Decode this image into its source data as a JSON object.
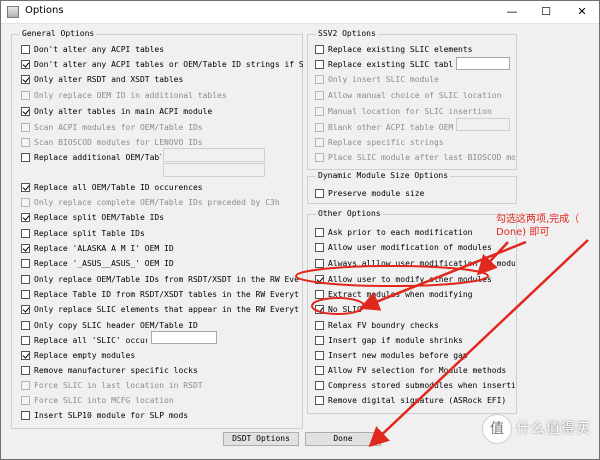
{
  "window": {
    "title": "Options",
    "minimize": "—",
    "maximize": "☐",
    "close": "✕"
  },
  "general": {
    "label": "General Options",
    "items": [
      {
        "label": "Don't alter any ACPI tables",
        "checked": false,
        "disabled": false
      },
      {
        "label": "Don't alter any ACPI tables or OEM/Table ID strings if SLIC IDs are",
        "checked": true,
        "disabled": false
      },
      {
        "label": "Only alter RSDT and XSDT tables",
        "checked": true,
        "disabled": false
      },
      {
        "label": "Only replace OEM ID in additional tables",
        "checked": false,
        "disabled": true
      },
      {
        "label": "Only alter tables in main ACPI module",
        "checked": true,
        "disabled": false
      },
      {
        "label": "Scan ACPI modules for OEM/Table IDs",
        "checked": false,
        "disabled": true
      },
      {
        "label": "Scan BIOSCOD modules for LENOVO IDs",
        "checked": false,
        "disabled": true
      },
      {
        "label": "Replace additional OEM/Table ID",
        "checked": false,
        "disabled": false
      },
      {
        "label": "Replace all OEM/Table ID occurences",
        "checked": true,
        "disabled": false
      },
      {
        "label": "Only replace complete OEM/Table IDs preceded by C3h",
        "checked": false,
        "disabled": true
      },
      {
        "label": "Replace split OEM/Table IDs",
        "checked": true,
        "disabled": false
      },
      {
        "label": "Replace split Table IDs",
        "checked": false,
        "disabled": false
      },
      {
        "label": "Replace 'ALASKA A M I' OEM ID",
        "checked": true,
        "disabled": false
      },
      {
        "label": "Replace '_ASUS__ASUS_' OEM ID",
        "checked": false,
        "disabled": false
      },
      {
        "label": "Only replace OEM/Table IDs from RSDT/XSDT in the RW Everything",
        "checked": false,
        "disabled": false
      },
      {
        "label": "Replace Table ID from RSDT/XSDT tables in the RW Everything report",
        "checked": false,
        "disabled": false
      },
      {
        "label": "Only replace SLIC elements that appear in the RW Everything report",
        "checked": true,
        "disabled": false
      },
      {
        "label": "Only copy SLIC header OEM/Table ID",
        "checked": false,
        "disabled": false
      },
      {
        "label": "Replace all 'SLIC' occurences",
        "checked": false,
        "disabled": false
      },
      {
        "label": "Replace empty modules",
        "checked": true,
        "disabled": false
      },
      {
        "label": "Remove manufacturer specific locks",
        "checked": false,
        "disabled": false
      },
      {
        "label": "Force SLIC in last location in RSDT",
        "checked": false,
        "disabled": true
      },
      {
        "label": "Force SLIC into MCFG location",
        "checked": false,
        "disabled": true
      },
      {
        "label": "Insert SLP10 module for SLP mods",
        "checked": false,
        "disabled": false
      }
    ]
  },
  "ssv2": {
    "label": "SSV2 Options",
    "items": [
      {
        "label": "Replace existing SLIC elements",
        "checked": false,
        "disabled": false
      },
      {
        "label": "Replace existing SLIC table ID with",
        "checked": false,
        "disabled": false
      },
      {
        "label": "Only insert SLIC module",
        "checked": false,
        "disabled": true
      },
      {
        "label": "Allow manual choice of SLIC location",
        "checked": false,
        "disabled": true
      },
      {
        "label": "Manual location for SLIC insertion",
        "checked": false,
        "disabled": true
      },
      {
        "label": "Blank other ACPI table OEM/Table",
        "checked": false,
        "disabled": true
      },
      {
        "label": "Replace specific strings",
        "checked": false,
        "disabled": true
      },
      {
        "label": "Place SLIC module after last BIOSCOD module",
        "checked": false,
        "disabled": true
      }
    ]
  },
  "dynamic": {
    "label": "Dynamic Module Size Options",
    "items": [
      {
        "label": "Preserve module size",
        "checked": false,
        "disabled": false
      }
    ]
  },
  "other": {
    "label": "Other Options",
    "items": [
      {
        "label": "Ask prior to each modification",
        "checked": false,
        "disabled": false
      },
      {
        "label": "Allow user modification of modules",
        "checked": false,
        "disabled": false
      },
      {
        "label": "Always alllow user modification of modules",
        "checked": false,
        "disabled": false
      },
      {
        "label": "Allow user to modify other modules",
        "checked": true,
        "disabled": false
      },
      {
        "label": "Extract modules when modifying",
        "checked": false,
        "disabled": false
      },
      {
        "label": "No SLIC",
        "checked": true,
        "disabled": false
      },
      {
        "label": "Relax FV boundry checks",
        "checked": false,
        "disabled": false
      },
      {
        "label": "Insert gap if module shrinks",
        "checked": false,
        "disabled": false
      },
      {
        "label": "Insert new modules before gap",
        "checked": false,
        "disabled": false
      },
      {
        "label": "Allow FV selection for Module methods",
        "checked": false,
        "disabled": false
      },
      {
        "label": "Compress stored submodules when inserting new modules",
        "checked": false,
        "disabled": false
      },
      {
        "label": "Remove digital signature (ASRock EFI)",
        "checked": false,
        "disabled": false
      }
    ]
  },
  "buttons": {
    "dsdt": "DSDT Options",
    "done": "Done"
  },
  "annotation": {
    "line1": "勾选这两项,完成（",
    "line2": "Done) 即可",
    "color": "#e0281e"
  },
  "watermark": {
    "glyph": "值",
    "text": "什么值得买"
  }
}
